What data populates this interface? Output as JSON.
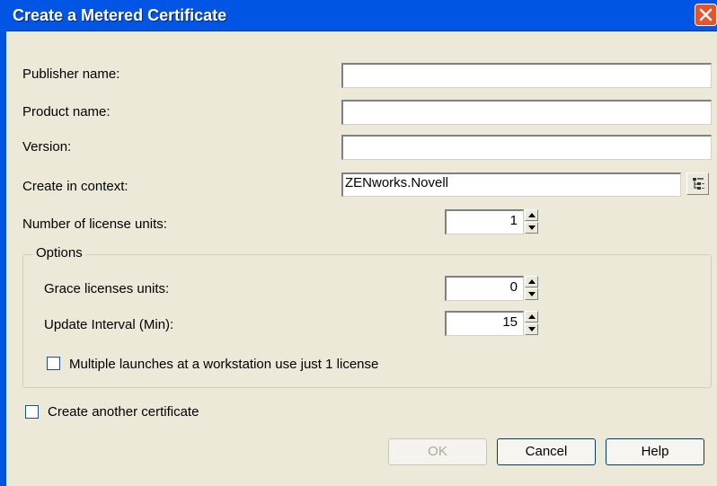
{
  "dialog": {
    "title": "Create a Metered Certificate",
    "accent": "#0055e5",
    "close_color": "#e2562f"
  },
  "fields": {
    "publisher_label": "Publisher name:",
    "publisher_value": "",
    "product_label": "Product name:",
    "product_value": "",
    "version_label": "Version:",
    "version_value": "",
    "context_label": "Create in context:",
    "context_value": "ZENworks.Novell",
    "license_units_label": "Number of license units:",
    "license_units_value": "1"
  },
  "options": {
    "legend": "Options",
    "grace_label": "Grace licenses units:",
    "grace_value": "0",
    "interval_label": "Update Interval (Min):",
    "interval_value": "15",
    "multiple_launch_label": "Multiple launches at a workstation use just 1 license",
    "multiple_launch_checked": false
  },
  "another": {
    "label": "Create another certificate",
    "checked": false
  },
  "buttons": {
    "ok": "OK",
    "cancel": "Cancel",
    "help": "Help"
  }
}
